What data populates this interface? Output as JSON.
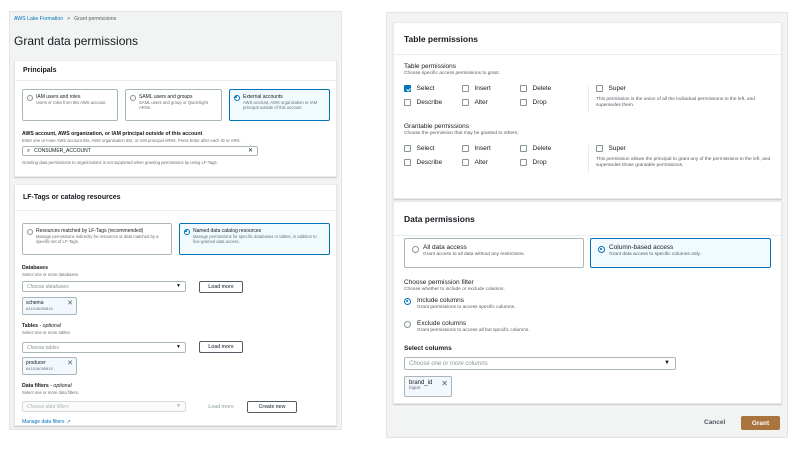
{
  "breadcrumb": {
    "parent": "AWS Lake Formation",
    "separator": ">",
    "current": "Grant permissions"
  },
  "page_title": "Grant data permissions",
  "principals": {
    "heading": "Principals",
    "options": [
      {
        "title": "IAM users and roles",
        "desc": "Users or roles from this AWS account.",
        "selected": false
      },
      {
        "title": "SAML users and groups",
        "desc": "SAML users and group or QuickSight ARNs.",
        "selected": false
      },
      {
        "title": "External accounts",
        "desc": "AWS account, AWS organization or IAM principal outside of this account",
        "selected": true
      }
    ],
    "account_label": "AWS account, AWS organization, or IAM principal outside of this account",
    "account_desc": "Enter one or more AWS account IDs, AWS organization IDs, or IAM principal ARNs. Press Enter after each ID or ARN.",
    "account_value": "CONSUMER_ACCOUNT",
    "note": "Granting data permissions to organizations is not supported when granting permissions by using LF-Tags."
  },
  "resources": {
    "heading": "LF-Tags or catalog resources",
    "options": [
      {
        "title": "Resources matched by LF-Tags (recommended)",
        "desc": "Manage permissions indirectly for resources or data matched by a specific set of LF-Tags.",
        "selected": false
      },
      {
        "title": "Named data catalog resources",
        "desc": "Manage permissions for specific databases or tables, in addition to fine-grained data access.",
        "selected": true
      }
    ],
    "databases": {
      "label": "Databases",
      "desc": "Select one or more databases.",
      "placeholder": "Choose databases",
      "button": "Load more",
      "token_name": "schema",
      "token_sub": "641518095815"
    },
    "tables": {
      "label": "Tables",
      "optional": "- optional",
      "desc": "Select one or more tables.",
      "placeholder": "Choose tables",
      "button": "Load more",
      "token_name": "producer",
      "token_sub": "641518095815"
    },
    "filters": {
      "label": "Data filters",
      "optional": "- optional",
      "desc": "Select one or more data filters.",
      "placeholder": "Choose data filters",
      "button": "Load more",
      "create_button": "Create new"
    },
    "manage_link": "Manage data filters"
  },
  "table_permissions": {
    "heading": "Table permissions",
    "perm_label": "Table permissions",
    "perm_desc": "Choose specific access permissions to grant.",
    "perms": [
      {
        "label": "Select",
        "checked": true
      },
      {
        "label": "Insert",
        "checked": false
      },
      {
        "label": "Delete",
        "checked": false
      },
      {
        "label": "Describe",
        "checked": false
      },
      {
        "label": "Alter",
        "checked": false
      },
      {
        "label": "Drop",
        "checked": false
      }
    ],
    "super": "Super",
    "super_desc": "This permission is the union of all the individual permissions to the left, and supersedes them.",
    "grantable_label": "Grantable permissions",
    "grantable_desc": "Choose the permission that may be granted to others.",
    "grantable": [
      {
        "label": "Select",
        "checked": false
      },
      {
        "label": "Insert",
        "checked": false
      },
      {
        "label": "Delete",
        "checked": false
      },
      {
        "label": "Describe",
        "checked": false
      },
      {
        "label": "Alter",
        "checked": false
      },
      {
        "label": "Drop",
        "checked": false
      }
    ],
    "grantable_super": "Super",
    "grantable_super_desc": "This permission allows the principal to grant any of the permissions to the left, and supersedes those grantable permissions."
  },
  "data_permissions": {
    "heading": "Data permissions",
    "options": [
      {
        "title": "All data access",
        "desc": "Grant access to all data without any restrictions.",
        "selected": false
      },
      {
        "title": "Column-based access",
        "desc": "Grant data access to specific columns only.",
        "selected": true
      }
    ],
    "filter_label": "Choose permission filter",
    "filter_desc": "Choose whether to include or exclude columns.",
    "filters": [
      {
        "title": "Include columns",
        "desc": "Grant permissions to access specific columns.",
        "selected": true
      },
      {
        "title": "Exclude columns",
        "desc": "Grant permissions to access all but specific columns.",
        "selected": false
      }
    ],
    "columns_label": "Select columns",
    "columns_placeholder": "Choose one or more columns",
    "column_token": {
      "name": "brand_id",
      "sub": "bigint"
    }
  },
  "footer": {
    "cancel": "Cancel",
    "grant": "Grant"
  },
  "colors": {
    "accent": "#0073bb",
    "primary_button": "#a9743d"
  }
}
